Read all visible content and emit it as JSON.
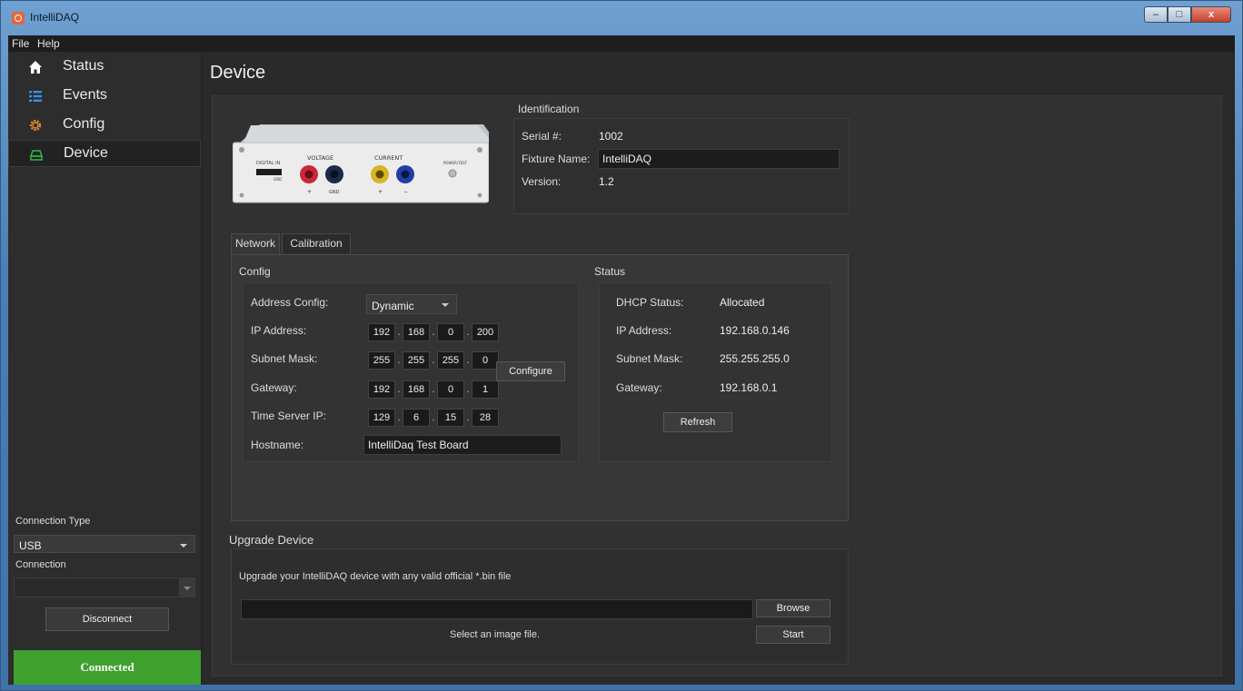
{
  "window": {
    "title": "IntelliDAQ",
    "min": "–",
    "max": "□",
    "close": "x"
  },
  "menu": [
    "File",
    "Help"
  ],
  "sidebar": {
    "items": [
      {
        "label": "Status",
        "icon": "home-icon"
      },
      {
        "label": "Events",
        "icon": "list-icon"
      },
      {
        "label": "Config",
        "icon": "gear-icon"
      },
      {
        "label": "Device",
        "icon": "device-icon"
      }
    ],
    "connection_type_label": "Connection Type",
    "connection_type_value": "USB",
    "connection_label": "Connection",
    "connection_value": "",
    "disconnect_label": "Disconnect",
    "status": "Connected",
    "status_color": "#3fa12e"
  },
  "page": {
    "title": "Device"
  },
  "device_image": {
    "voltage": "VOLTAGE",
    "current": "CURRENT",
    "digital_in": "DIGITAL IN",
    "gnd_small": "GND",
    "plus": "+",
    "gnd": "GND",
    "plus2": "+",
    "minus": "−",
    "power": "POWER/TEST",
    "colors": {
      "red": "#c8283a",
      "blue": "#1f3fa6",
      "yellow": "#d8b420"
    }
  },
  "identification": {
    "title": "Identification",
    "serial_label": "Serial #:",
    "serial_value": "1002",
    "fixture_label": "Fixture Name:",
    "fixture_value": "IntelliDAQ",
    "version_label": "Version:",
    "version_value": "1.2"
  },
  "tabs": [
    {
      "label": "Network",
      "active": true
    },
    {
      "label": "Calibration",
      "active": false
    }
  ],
  "network": {
    "config_title": "Config",
    "address_config_label": "Address Config:",
    "address_config_value": "Dynamic",
    "ip_label": "IP Address:",
    "ip": [
      "192",
      "168",
      "0",
      "200"
    ],
    "subnet_label": "Subnet Mask:",
    "subnet": [
      "255",
      "255",
      "255",
      "0"
    ],
    "gateway_label": "Gateway:",
    "gateway": [
      "192",
      "168",
      "0",
      "1"
    ],
    "timeserver_label": "Time Server IP:",
    "timeserver": [
      "129",
      "6",
      "15",
      "28"
    ],
    "hostname_label": "Hostname:",
    "hostname_value": "IntelliDaq Test Board",
    "configure_label": "Configure",
    "status_title": "Status",
    "dhcp_label": "DHCP Status:",
    "dhcp_value": "Allocated",
    "s_ip_label": "IP Address:",
    "s_ip_value": "192.168.0.146",
    "s_subnet_label": "Subnet Mask:",
    "s_subnet_value": "255.255.255.0",
    "s_gateway_label": "Gateway:",
    "s_gateway_value": "192.168.0.1",
    "refresh_label": "Refresh"
  },
  "upgrade": {
    "title": "Upgrade Device",
    "description": "Upgrade your IntelliDAQ device with any valid official *.bin file",
    "file_value": "",
    "browse_label": "Browse",
    "start_label": "Start",
    "hint": "Select an image file."
  }
}
